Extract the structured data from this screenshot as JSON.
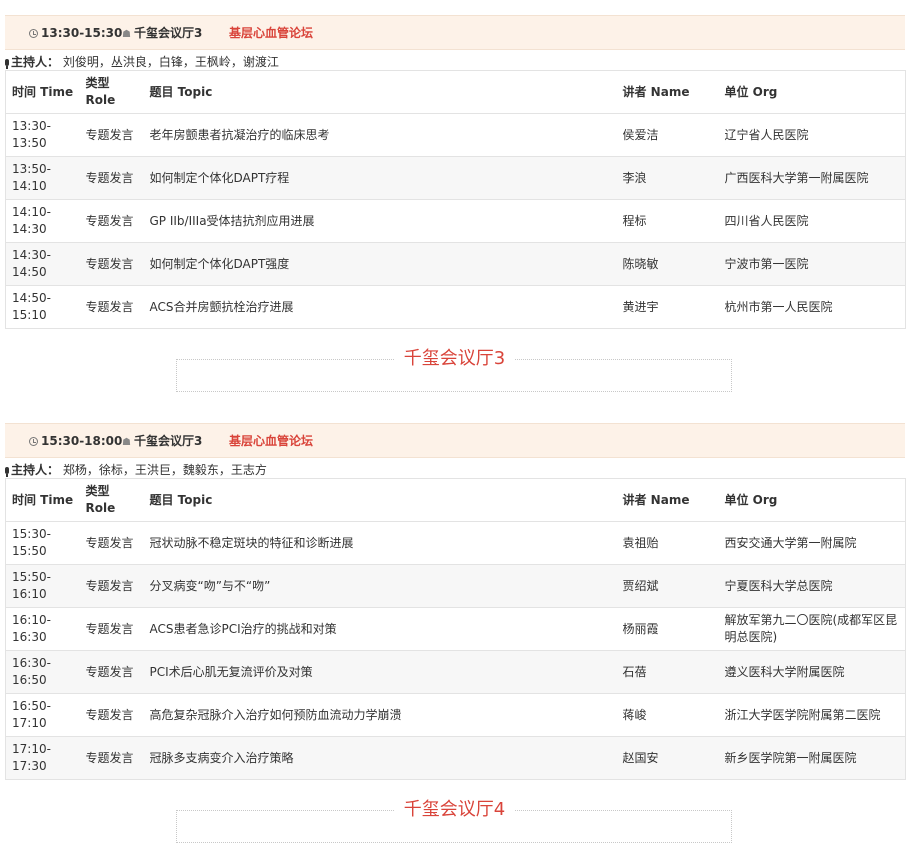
{
  "sessions": [
    {
      "time": "13:30-15:30",
      "hall": "千玺会议厅3",
      "forum": "基层心血管论坛",
      "host_label": "主持人：",
      "hosts": "刘俊明，丛洪良，白锋，王枫岭，谢渡江",
      "columns": {
        "time_l1": "时间 Time",
        "role_l1": "类型",
        "role_l2": "Role",
        "topic": "题目 Topic",
        "speaker": "讲者 Name",
        "org": "单位 Org"
      },
      "rows": [
        {
          "start": "13:30-",
          "end": "13:50",
          "role": "专题发言",
          "topic": "老年房颤患者抗凝治疗的临床思考",
          "speaker": "侯爱洁",
          "org": "辽宁省人民医院"
        },
        {
          "start": "13:50-",
          "end": "14:10",
          "role": "专题发言",
          "topic": "如何制定个体化DAPT疗程",
          "speaker": "李浪",
          "org": "广西医科大学第一附属医院"
        },
        {
          "start": "14:10-",
          "end": "14:30",
          "role": "专题发言",
          "topic": "GP IIb/IIIa受体拮抗剂应用进展",
          "speaker": "程标",
          "org": "四川省人民医院"
        },
        {
          "start": "14:30-",
          "end": "14:50",
          "role": "专题发言",
          "topic": "如何制定个体化DAPT强度",
          "speaker": "陈晓敏",
          "org": "宁波市第一医院"
        },
        {
          "start": "14:50-",
          "end": "15:10",
          "role": "专题发言",
          "topic": "ACS合并房颤抗栓治疗进展",
          "speaker": "黄进宇",
          "org": "杭州市第一人民医院"
        }
      ],
      "next_hall": "千玺会议厅3"
    },
    {
      "time": "15:30-18:00",
      "hall": "千玺会议厅3",
      "forum": "基层心血管论坛",
      "host_label": "主持人：",
      "hosts": "郑杨，徐标，王洪巨，魏毅东，王志方",
      "columns": {
        "time_l1": "时间 Time",
        "role_l1": "类型",
        "role_l2": "Role",
        "topic": "题目 Topic",
        "speaker": "讲者 Name",
        "org": "单位 Org"
      },
      "rows": [
        {
          "start": "15:30-",
          "end": "15:50",
          "role": "专题发言",
          "topic": "冠状动脉不稳定斑块的特征和诊断进展",
          "speaker": "袁祖贻",
          "org": "西安交通大学第一附属院"
        },
        {
          "start": "15:50-",
          "end": "16:10",
          "role": "专题发言",
          "topic": "分叉病变“吻”与不“吻”",
          "speaker": "贾绍斌",
          "org": "宁夏医科大学总医院"
        },
        {
          "start": "16:10-",
          "end": "16:30",
          "role": "专题发言",
          "topic": "ACS患者急诊PCI治疗的挑战和对策",
          "speaker": "杨丽霞",
          "org": "解放军第九二〇医院(成都军区昆明总医院)"
        },
        {
          "start": "16:30-",
          "end": "16:50",
          "role": "专题发言",
          "topic": "PCI术后心肌无复流评价及对策",
          "speaker": "石蓓",
          "org": "遵义医科大学附属医院"
        },
        {
          "start": "16:50-",
          "end": "17:10",
          "role": "专题发言",
          "topic": "高危复杂冠脉介入治疗如何预防血流动力学崩溃",
          "speaker": "蒋峻",
          "org": "浙江大学医学院附属第二医院"
        },
        {
          "start": "17:10-",
          "end": "17:30",
          "role": "专题发言",
          "topic": "冠脉多支病变介入治疗策略",
          "speaker": "赵国安",
          "org": "新乡医学院第一附属医院"
        }
      ],
      "next_hall": "千玺会议厅4"
    }
  ]
}
